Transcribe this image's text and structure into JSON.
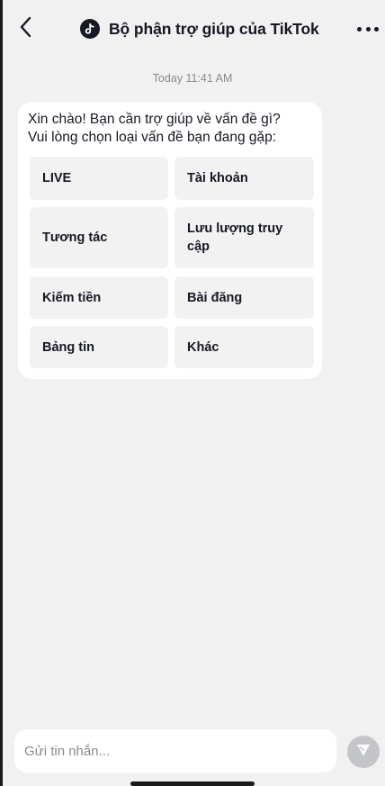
{
  "header": {
    "title": "Bộ phận trợ giúp của TikTok",
    "back_icon": "chevron-left-icon",
    "logo_icon": "tiktok-logo-icon",
    "more_icon": "more-horizontal-icon"
  },
  "chat": {
    "timestamp": "Today 11:41 AM",
    "message": {
      "line1": "Xin chào! Bạn cần trợ giúp về vấn đề gì?",
      "line2": "Vui lòng chọn loại vấn đề bạn đang gặp:"
    },
    "options": {
      "live": "LIVE",
      "account": "Tài khoản",
      "engagement": "Tương tác",
      "traffic_line1": "Lưu lượng truy",
      "traffic_line2": "cập",
      "monetization": "Kiếm tiền",
      "posts": "Bài đăng",
      "feed": "Bảng tin",
      "other": "Khác"
    }
  },
  "composer": {
    "placeholder": "Gửi tin nhắn...",
    "value": "",
    "send_icon": "send-icon"
  },
  "colors": {
    "background": "#f1f1f2",
    "bubble": "#ffffff",
    "option_bg": "#f2f2f3",
    "text": "#161823",
    "muted": "#8a8b91",
    "send_disabled": "#c4c5c9"
  }
}
